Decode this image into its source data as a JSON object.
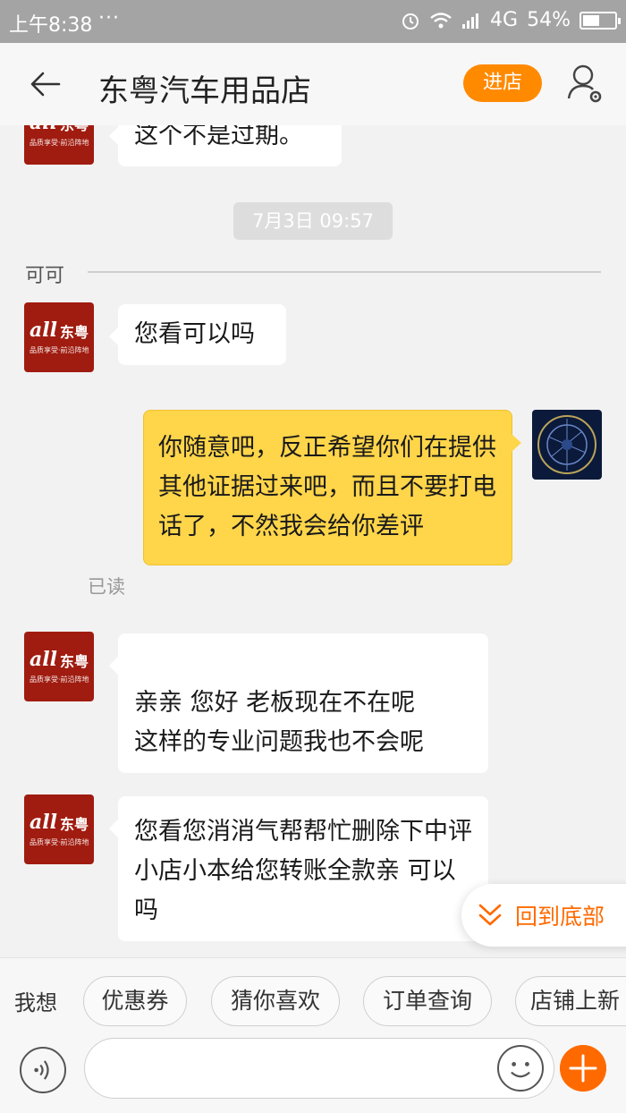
{
  "status_bar": {
    "time": "上午8:38",
    "dots": "···",
    "network": "4G",
    "battery_percent": "54%",
    "battery_level": 0.54
  },
  "header": {
    "title": "东粤汽车用品店",
    "enter_store_label": "进店",
    "back_icon": "back-arrow-icon",
    "settings_icon": "user-settings-icon"
  },
  "chat": {
    "partial_message": "这个不是过期。",
    "timestamp": "7月3日 09:57",
    "sender_name": "可可",
    "messages": [
      {
        "from": "store",
        "text": "您看可以吗"
      },
      {
        "from": "me",
        "text": "你随意吧，反正希望你们在提供其他证据过来吧，而且不要打电话了，不然我会给你差评",
        "status": "已读"
      },
      {
        "from": "store",
        "text": "亲亲 您好 老板现在不在呢\n这样的专业问题我也不会呢"
      },
      {
        "from": "store",
        "text": "您看您消消气帮帮忙删除下中评 小店小本给您转账全款亲 可以吗"
      }
    ],
    "store_avatar": {
      "brand": "all",
      "brand_cn": "东粤",
      "slogan": "品质享受·前沿阵地"
    },
    "scroll_to_bottom_label": "回到底部"
  },
  "quick_replies": {
    "lead": "我想",
    "chips": [
      "优惠券",
      "猜你喜欢",
      "订单查询",
      "店铺上新"
    ]
  },
  "input_bar": {
    "value": "",
    "voice_icon": "voice-icon",
    "emoji_icon": "emoji-icon",
    "plus_icon": "plus-icon"
  },
  "colors": {
    "accent": "#ff8a00",
    "my_bubble": "#ffd54a",
    "store_avatar_bg": "#a01c10",
    "status_bar_bg": "#a4a4a4"
  }
}
